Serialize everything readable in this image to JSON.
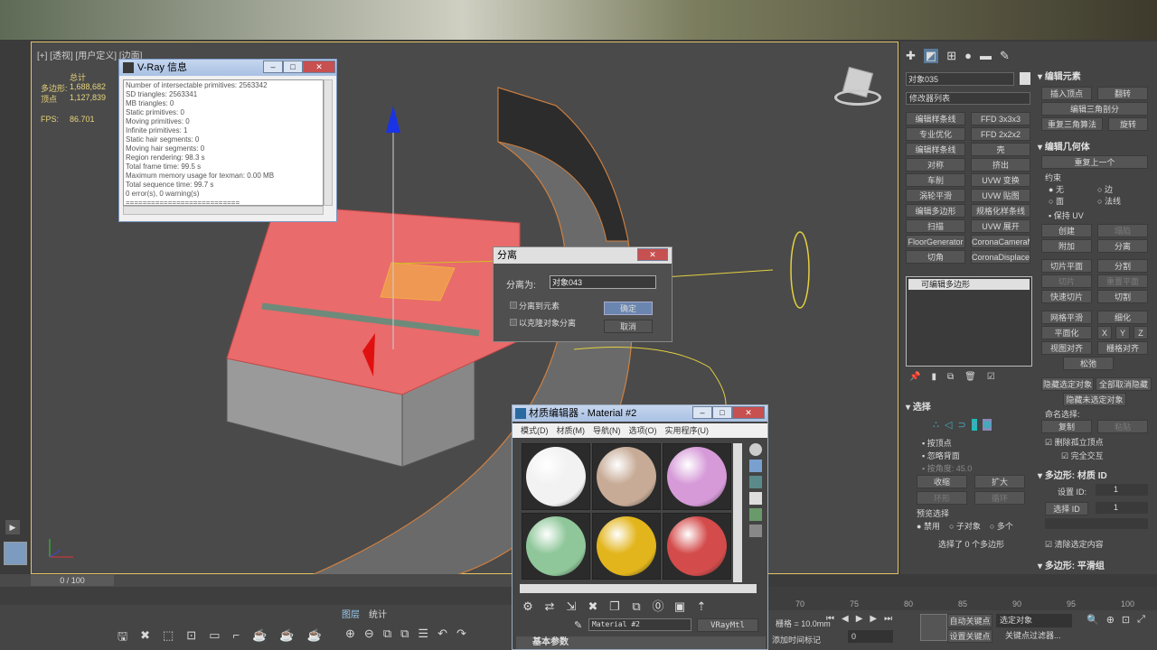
{
  "viewport": {
    "label": "[+] [透视] [用户定义] [边面]",
    "stats_header": "总计",
    "polys_label": "多边形:",
    "polys_value": "1,688,682",
    "verts_label": "顶点",
    "verts_value": "1,127,839",
    "fps_label": "FPS:",
    "fps_value": "86.701"
  },
  "vray_window": {
    "title": "V-Ray 信息",
    "lines": [
      "Number of intersectable primitives: 2563342",
      "SD triangles: 2563341",
      "MB triangles: 0",
      "Static primitives: 0",
      "Moving primitives: 0",
      "Infinite primitives: 1",
      "Static hair segments: 0",
      "Moving hair segments: 0",
      "Region rendering: 98.3 s",
      "Total frame time: 99.5 s",
      "Maximum memory usage for texman: 0.00 MB",
      "Total sequence time: 99.7 s",
      "0 error(s), 0 warning(s)",
      "==========================="
    ]
  },
  "detach_dialog": {
    "title": "分离",
    "name_label": "分离为:",
    "name_value": "对象043",
    "option1": "分离到元素",
    "option2": "以克隆对象分离",
    "ok": "确定",
    "cancel": "取消"
  },
  "material_editor": {
    "title": "材质编辑器 - Material #2",
    "menus": [
      "模式(D)",
      "材质(M)",
      "导航(N)",
      "选项(O)",
      "实用程序(U)"
    ],
    "material_name": "Material #2",
    "type_button": "VRayMtl",
    "rollout": "基本参数",
    "slot_colors": [
      "#f2f2f2",
      "#c7ab96",
      "#d69ad8",
      "#8fc79a",
      "#e2b51c",
      "#d44b4b"
    ]
  },
  "command_panel": {
    "object_name": "对象035",
    "modifier_list": "修改器列表",
    "buttons": [
      [
        "编辑样条线",
        "FFD 3x3x3"
      ],
      [
        "专业优化",
        "FFD 2x2x2"
      ],
      [
        "编辑样条线",
        "壳"
      ],
      [
        "对称",
        "挤出"
      ],
      [
        "车削",
        "UVW 变换"
      ],
      [
        "涡轮平滑",
        "UVW 贴图"
      ],
      [
        "编辑多边形",
        "规格化样条线"
      ],
      [
        "扫描",
        "UVW 展开"
      ],
      [
        "FloorGenerator",
        "CoronaCameraMod"
      ],
      [
        "切角",
        "CoronaDisplacement"
      ]
    ],
    "stack_item": "可编辑多边形"
  },
  "edit_elements": {
    "title": "编辑元素",
    "insert_vertex": "插入顶点",
    "flip": "翻转",
    "edit_tri": "编辑三角剖分",
    "retri": "重复三角算法",
    "turn": "旋转"
  },
  "edit_geometry": {
    "title": "编辑几何体",
    "repeat_last": "重复上一个",
    "constraints": "约束",
    "c_none": "无",
    "c_edge": "边",
    "c_face": "面",
    "c_normal": "法线",
    "preserve_uv": "保持 UV",
    "create": "创建",
    "collapse": "塌陷",
    "attach": "附加",
    "detach": "分离",
    "slice_plane": "切片平面",
    "split": "分割",
    "slice": "切片",
    "reset_plane": "重置平面",
    "quickslice": "快速切片",
    "cut": "切割",
    "meshsmooth": "网格平滑",
    "tessellate": "细化",
    "planarize": "平面化",
    "x": "X",
    "y": "Y",
    "z": "Z",
    "view_align": "视图对齐",
    "grid_align": "栅格对齐",
    "relax": "松弛",
    "hide_sel": "隐藏选定对象",
    "unhide_all": "全部取消隐藏",
    "hide_unsel": "隐藏未选定对象",
    "named_sel": "命名选择:",
    "copy": "复制",
    "paste": "粘贴",
    "delete_iso": "删除孤立顶点",
    "full_interact": "完全交互"
  },
  "selection": {
    "title": "选择",
    "by_vertex": "按顶点",
    "ignore_back": "忽略背面",
    "by_angle": "按角度:",
    "angle_value": "45.0",
    "shrink": "收缩",
    "grow": "扩大",
    "ring": "环形",
    "loop": "循环",
    "preview": "预览选择",
    "p_off": "禁用",
    "p_sub": "子对象",
    "p_multi": "多个",
    "status": "选择了 0 个多边形"
  },
  "poly_material": {
    "title": "多边形: 材质 ID",
    "set_id": "设置 ID:",
    "set_id_value": "1",
    "select_id": "选择 ID",
    "select_id_value": "1",
    "clear_sel": "清除选定内容"
  },
  "poly_smooth": {
    "title": "多边形: 平滑组"
  },
  "timeline": {
    "counter": "0 / 100",
    "ticks": [
      "70",
      "75",
      "80",
      "85",
      "90",
      "95",
      "100"
    ]
  },
  "bottom": {
    "tab_layers": "图层",
    "tab_stats": "统计",
    "grid": "栅格 = 10.0mm",
    "add_tag": "添加时间标记",
    "autokey": "自动关键点",
    "sel_obj": "选定对象",
    "setkey": "设置关键点",
    "keyfilter": "关键点过滤器...",
    "frame": "0"
  }
}
